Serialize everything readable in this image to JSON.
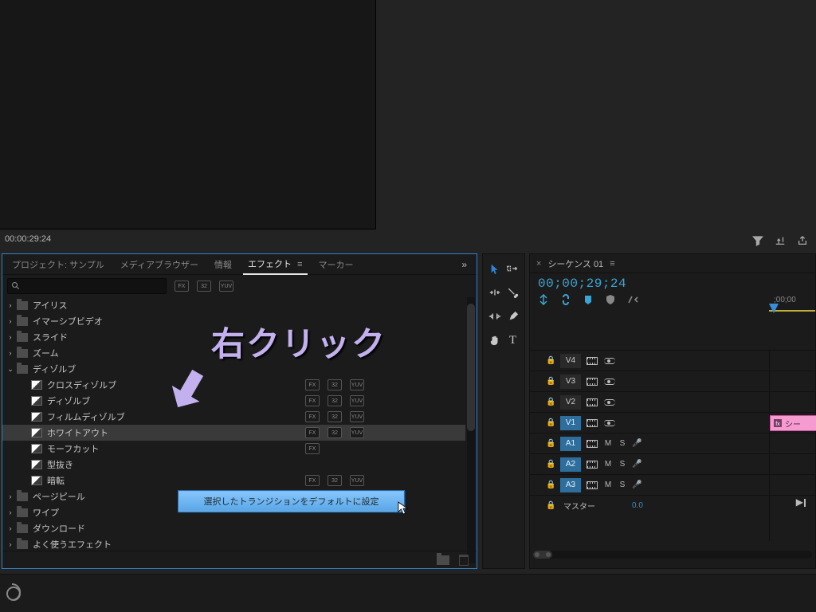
{
  "source": {
    "timecode": "00:00:29:24"
  },
  "program_bar": {
    "filter_icon": "filter-icon",
    "insert_icon": "insert-icon",
    "export_icon": "export-icon"
  },
  "effects_panel": {
    "tabs": {
      "project": "プロジェクト: サンプル",
      "media_browser": "メディアブラウザー",
      "info": "情報",
      "effects": "エフェクト",
      "markers": "マーカー"
    },
    "badges": {
      "a": "FX",
      "b": "32",
      "c": "YUV"
    },
    "tree": [
      {
        "depth": 1,
        "kind": "folder",
        "open": false,
        "label": "アイリス"
      },
      {
        "depth": 1,
        "kind": "folder",
        "open": false,
        "label": "イマーシブビデオ"
      },
      {
        "depth": 1,
        "kind": "folder",
        "open": false,
        "label": "スライド"
      },
      {
        "depth": 1,
        "kind": "folder",
        "open": false,
        "label": "ズーム"
      },
      {
        "depth": 1,
        "kind": "folder",
        "open": true,
        "label": "ディゾルブ"
      },
      {
        "depth": 2,
        "kind": "fx",
        "label": "クロスディゾルブ",
        "badges": [
          "FX",
          "32",
          "YUV"
        ]
      },
      {
        "depth": 2,
        "kind": "fx",
        "label": "ディゾルブ",
        "badges": [
          "FX",
          "32",
          "YUV"
        ]
      },
      {
        "depth": 2,
        "kind": "fx",
        "label": "フィルムディゾルブ",
        "badges": [
          "FX",
          "32",
          "YUV"
        ]
      },
      {
        "depth": 2,
        "kind": "fx",
        "label": "ホワイトアウト",
        "badges": [
          "FX",
          "32",
          "YUV"
        ],
        "selected": true
      },
      {
        "depth": 2,
        "kind": "fx",
        "label": "モーフカット",
        "badges": [
          "FX"
        ]
      },
      {
        "depth": 2,
        "kind": "fx",
        "label": "型抜き"
      },
      {
        "depth": 2,
        "kind": "fx",
        "label": "暗転",
        "badges": [
          "FX",
          "32",
          "YUV"
        ]
      },
      {
        "depth": 1,
        "kind": "folder",
        "open": false,
        "label": "ページピール"
      },
      {
        "depth": 1,
        "kind": "folder",
        "open": false,
        "label": "ワイプ"
      },
      {
        "depth": 1,
        "kind": "folder-dl",
        "open": false,
        "label": "ダウンロード"
      },
      {
        "depth": 1,
        "kind": "folder-fav",
        "open": false,
        "label": "よく使うエフェクト"
      }
    ],
    "context_menu": {
      "item": "選択したトランジションをデフォルトに設定"
    }
  },
  "annotation": {
    "text": "右クリック"
  },
  "tools": {
    "items": [
      "selection-tool",
      "track-select-tool",
      "ripple-edit-tool",
      "razor-tool",
      "slip-tool",
      "pen-tool",
      "hand-tool",
      "type-tool"
    ]
  },
  "timeline": {
    "close_x": "×",
    "title": "シーケンス 01",
    "timecode": "00;00;29;24",
    "ruler0": ";00;00",
    "tracks": {
      "v4": "V4",
      "v3": "V3",
      "v2": "V2",
      "v1": "V1",
      "a1": "A1",
      "a2": "A2",
      "a3": "A3",
      "master_label": "マスター",
      "master_value": "0.0",
      "m": "M",
      "s": "S"
    },
    "clip": {
      "label": "シー"
    },
    "end_marker": "▶│"
  }
}
